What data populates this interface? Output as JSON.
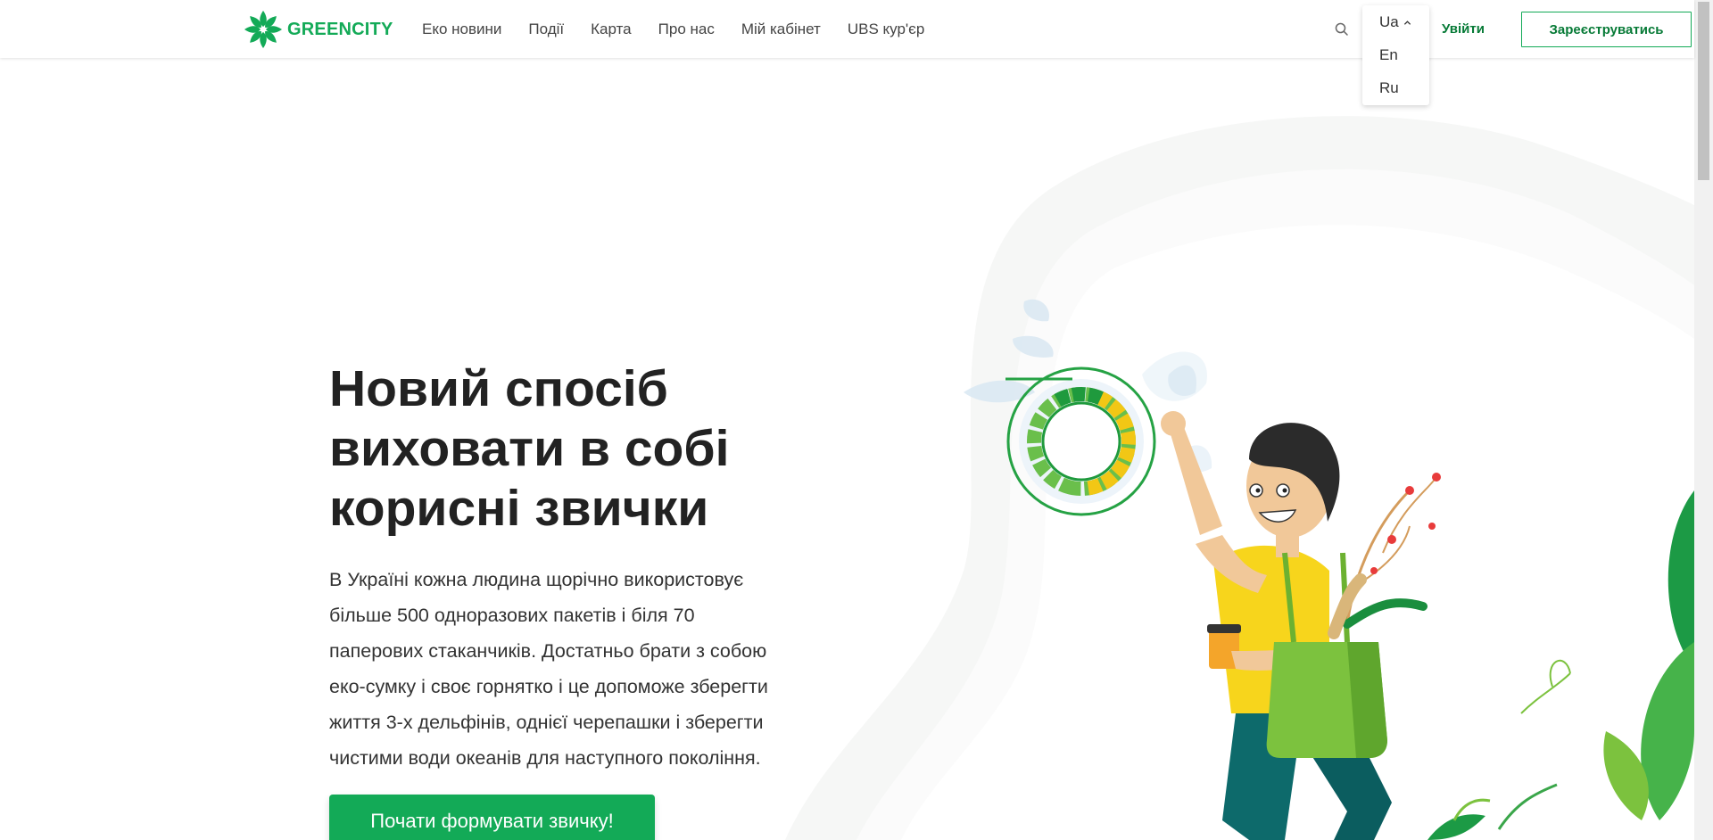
{
  "brand": {
    "name": "GREENCITY",
    "color": "#13aa57"
  },
  "nav": {
    "items": [
      {
        "label": "Еко новини"
      },
      {
        "label": "Події"
      },
      {
        "label": "Карта"
      },
      {
        "label": "Про нас"
      },
      {
        "label": "Мій кабінет"
      },
      {
        "label": "UBS кур'єр"
      }
    ]
  },
  "language": {
    "current": "Ua",
    "options": [
      "En",
      "Ru"
    ]
  },
  "auth": {
    "login_label": "Увійти",
    "register_label": "Зареєструватись"
  },
  "hero": {
    "title": "Новий спосіб виховати в собі корисні звички",
    "text": "В Україні кожна людина щорічно використовує більше 500 одноразових пакетів і біля 70 паперових стаканчиків. Достатньо брати з собою еко-сумку і своє горнятко і це допоможе зберегти життя 3-х дельфінів, однієї черепашки і зберегти чистими води океанів для наступного покоління.",
    "cta_label": "Почати формувати звичку!"
  },
  "icons": {
    "search": "search-icon",
    "chevron": "chevron-up-icon",
    "logo": "greencity-flower-logo"
  }
}
